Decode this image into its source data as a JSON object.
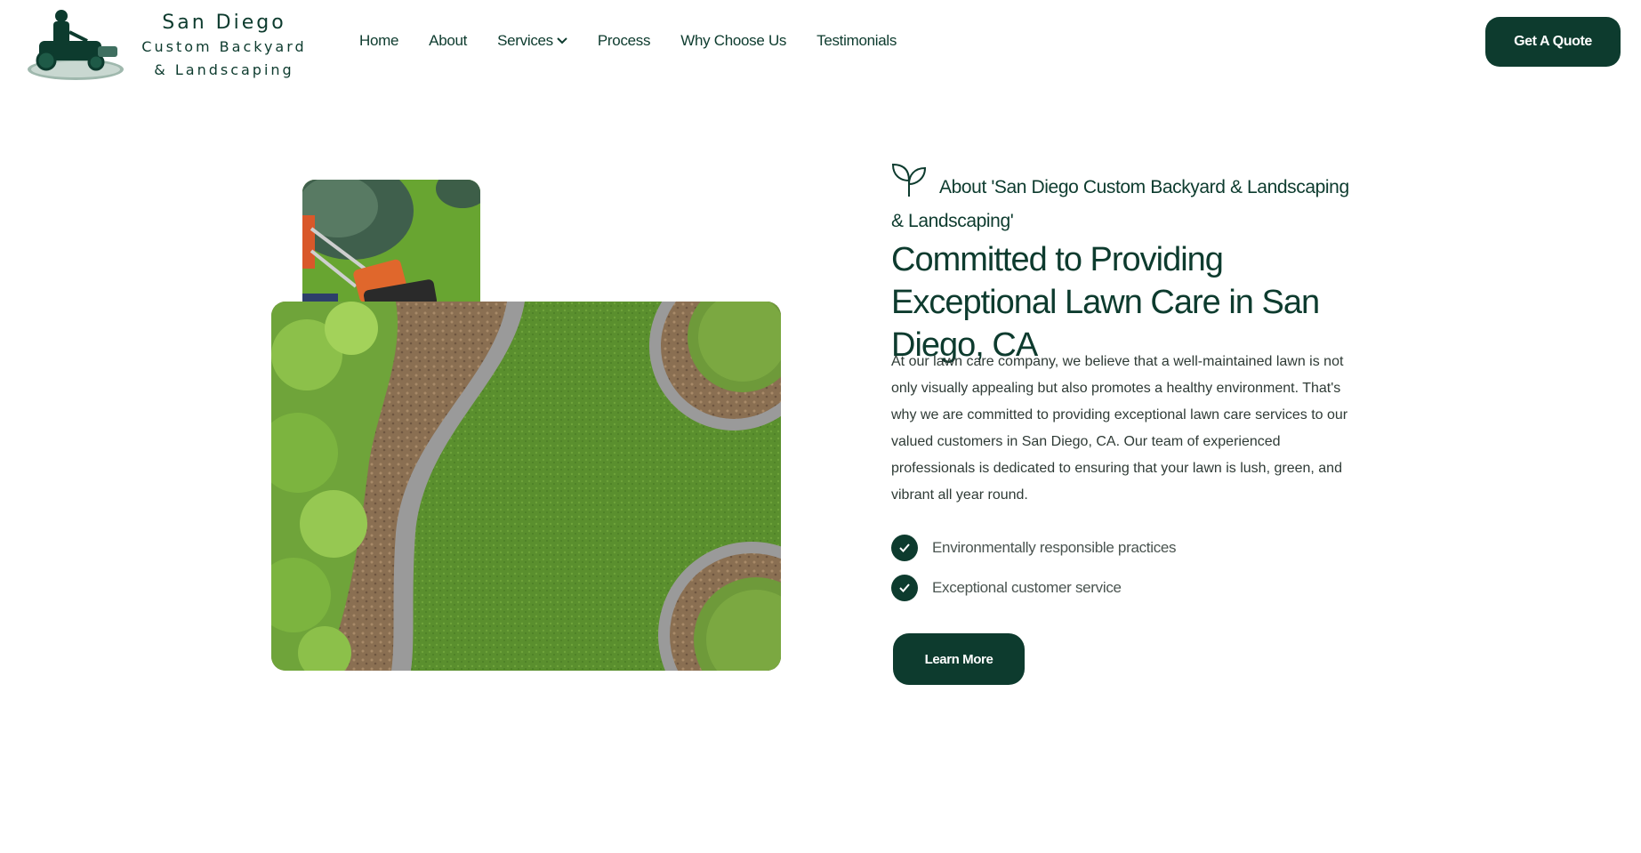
{
  "brand": {
    "line1": "San Diego",
    "line2": "Custom Backyard",
    "line3": "& Landscaping"
  },
  "nav": {
    "items": [
      {
        "label": "Home"
      },
      {
        "label": "About"
      },
      {
        "label": "Services",
        "icon": "chevron-down-icon"
      },
      {
        "label": "Process"
      },
      {
        "label": "Why Choose Us"
      },
      {
        "label": "Testimonials"
      }
    ],
    "cta_label": "Get A Quote"
  },
  "about": {
    "label": "About 'San Diego Custom Backyard & Landscaping & Landscaping'",
    "headline": "Committed to Providing Exceptional Lawn Care in San Diego, CA",
    "paragraph": "At our lawn care company, we believe that a well-maintained lawn is not only visually appealing but also promotes a healthy environment. That's why we are committed to providing exceptional lawn care services to our valued customers in San Diego, CA. Our team of experienced professionals is dedicated to ensuring that your lawn is lush, green, and vibrant all year round.",
    "features": [
      {
        "text": "Environmentally responsible practices"
      },
      {
        "text": "Exceptional customer service"
      }
    ],
    "button_label": "Learn More"
  },
  "colors": {
    "brand_dark_green": "#0d3b2e",
    "body_text": "#2f3b36"
  }
}
